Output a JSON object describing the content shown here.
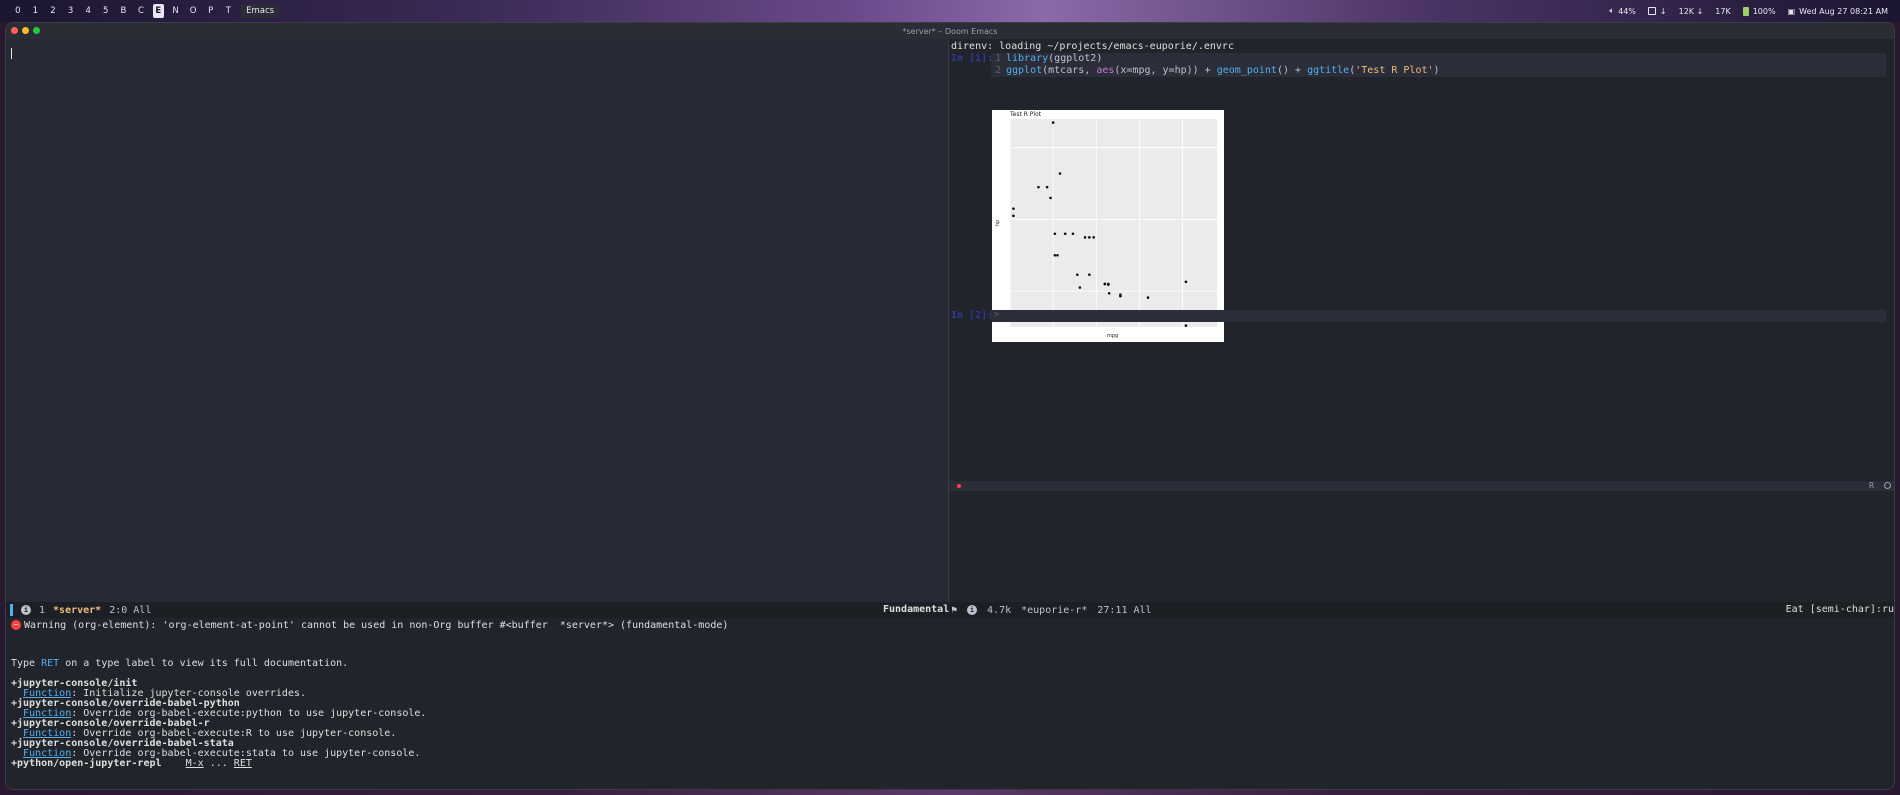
{
  "menubar": {
    "workspaces": [
      "0",
      "1",
      "2",
      "3",
      "4",
      "5",
      "B",
      "C",
      "E",
      "N",
      "O",
      "P",
      "T"
    ],
    "active_workspace": "E",
    "app": "Emacs",
    "status": {
      "volume": "44%",
      "net_down": "12K ↓",
      "net_up": "17K",
      "battery": "100%",
      "datetime": "Wed Aug 27 08:21 AM"
    }
  },
  "window": {
    "title": "*server* – Doom Emacs"
  },
  "right_pane": {
    "direnv": "direnv: loading ~/projects/emacs-euporie/.envrc",
    "in_prompt": "In [1]:",
    "code": {
      "line1_no": "1",
      "line1_fn": "library",
      "line1_rest": "(ggplot2)",
      "line2_no": "2",
      "line2_fn": "ggplot",
      "line2_a": "(mtcars, ",
      "line2_aes": "aes",
      "line2_b": "(x=mpg, y=hp)) + ",
      "line2_geom": "geom_point",
      "line2_c": "() + ",
      "line2_ggtitle": "ggtitle",
      "line2_d": "(",
      "line2_str": "'Test R Plot'",
      "line2_e": ")"
    },
    "plot": {
      "title": "Test R Plot",
      "xlabel": "mpg",
      "ylabel": "hp"
    },
    "in_prompt2": "In [2]:",
    "caret": ">",
    "kernel": "R"
  },
  "chart_data": {
    "type": "scatter",
    "title": "Test R Plot",
    "xlabel": "mpg",
    "ylabel": "hp",
    "xlim": [
      10,
      34
    ],
    "ylim": [
      50,
      340
    ],
    "x": [
      21.0,
      21.0,
      22.8,
      21.4,
      18.7,
      18.1,
      14.3,
      24.4,
      22.8,
      19.2,
      17.8,
      16.4,
      17.3,
      15.2,
      10.4,
      10.4,
      14.7,
      32.4,
      30.4,
      33.9,
      21.5,
      15.5,
      15.2,
      13.3,
      19.2,
      27.3,
      26.0,
      30.4,
      15.8,
      19.7,
      15.0,
      21.4
    ],
    "y": [
      110,
      110,
      93,
      110,
      175,
      105,
      245,
      62,
      95,
      123,
      123,
      180,
      180,
      180,
      205,
      215,
      230,
      66,
      52,
      65,
      97,
      150,
      150,
      245,
      175,
      66,
      91,
      113,
      264,
      175,
      335,
      109
    ]
  },
  "modeline_left": {
    "info": "i",
    "num": "1",
    "buffer": "*server*",
    "pos": "2:0 All",
    "major": "Fundamental"
  },
  "modeline_right": {
    "size": "4.7k",
    "buffer": "*euporie-r*",
    "pos": "27:11 All",
    "mode": "Eat [semi-char]:ru"
  },
  "echo": {
    "warning": "Warning (org-element): 'org-element-at-point' cannot be used in non-Org buffer #<buffer  *server*> (fundamental-mode)",
    "type_pre": "Type ",
    "type_key": "RET",
    "type_post": " on a type label to view its full documentation.",
    "items": [
      {
        "name": "+jupyter-console/init",
        "kind": "Function",
        "desc": ": Initialize jupyter-console overrides."
      },
      {
        "name": "+jupyter-console/override-babel-python",
        "kind": "Function",
        "desc": ": Override org-babel-execute:python to use jupyter-console."
      },
      {
        "name": "+jupyter-console/override-babel-r",
        "kind": "Function",
        "desc": ": Override org-babel-execute:R to use jupyter-console."
      },
      {
        "name": "+jupyter-console/override-babel-stata",
        "kind": "Function",
        "desc": ": Override org-babel-execute:stata to use jupyter-console."
      }
    ],
    "last_name": "+python/open-jupyter-repl",
    "last_key1": "M-x",
    "last_dots": "...",
    "last_key2": "RET"
  }
}
